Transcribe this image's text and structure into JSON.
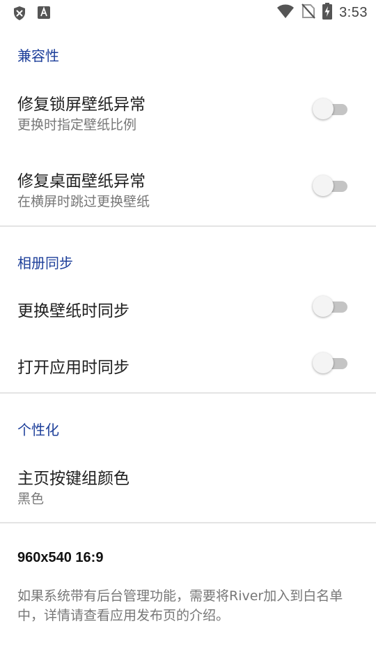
{
  "status_bar": {
    "time": "3:53",
    "left_icons": [
      "shield-x-icon",
      "font-a-icon"
    ],
    "right_icons": [
      "wifi-icon",
      "no-sim-icon",
      "battery-charging-icon"
    ]
  },
  "sections": {
    "compat": {
      "title": "兼容性",
      "items": [
        {
          "title": "修复锁屏壁纸异常",
          "subtitle": "更换时指定壁纸比例",
          "enabled": false
        },
        {
          "title": "修复桌面壁纸异常",
          "subtitle": "在横屏时跳过更换壁纸",
          "enabled": false
        }
      ]
    },
    "album": {
      "title": "相册同步",
      "items": [
        {
          "title": "更换壁纸时同步",
          "enabled": false
        },
        {
          "title": "打开应用时同步",
          "enabled": false
        }
      ]
    },
    "personal": {
      "title": "个性化",
      "items": [
        {
          "title": "主页按键组颜色",
          "subtitle": "黑色"
        }
      ]
    }
  },
  "info": {
    "resolution": "960x540  16:9",
    "note": "如果系统带有后台管理功能，需要将River加入到白名单中，详情请查看应用发布页的介绍。"
  },
  "colors": {
    "section_accent": "#1d3f9a",
    "switch_track_off": "#c4c4c4",
    "switch_thumb_off": "#f4f4f4"
  }
}
